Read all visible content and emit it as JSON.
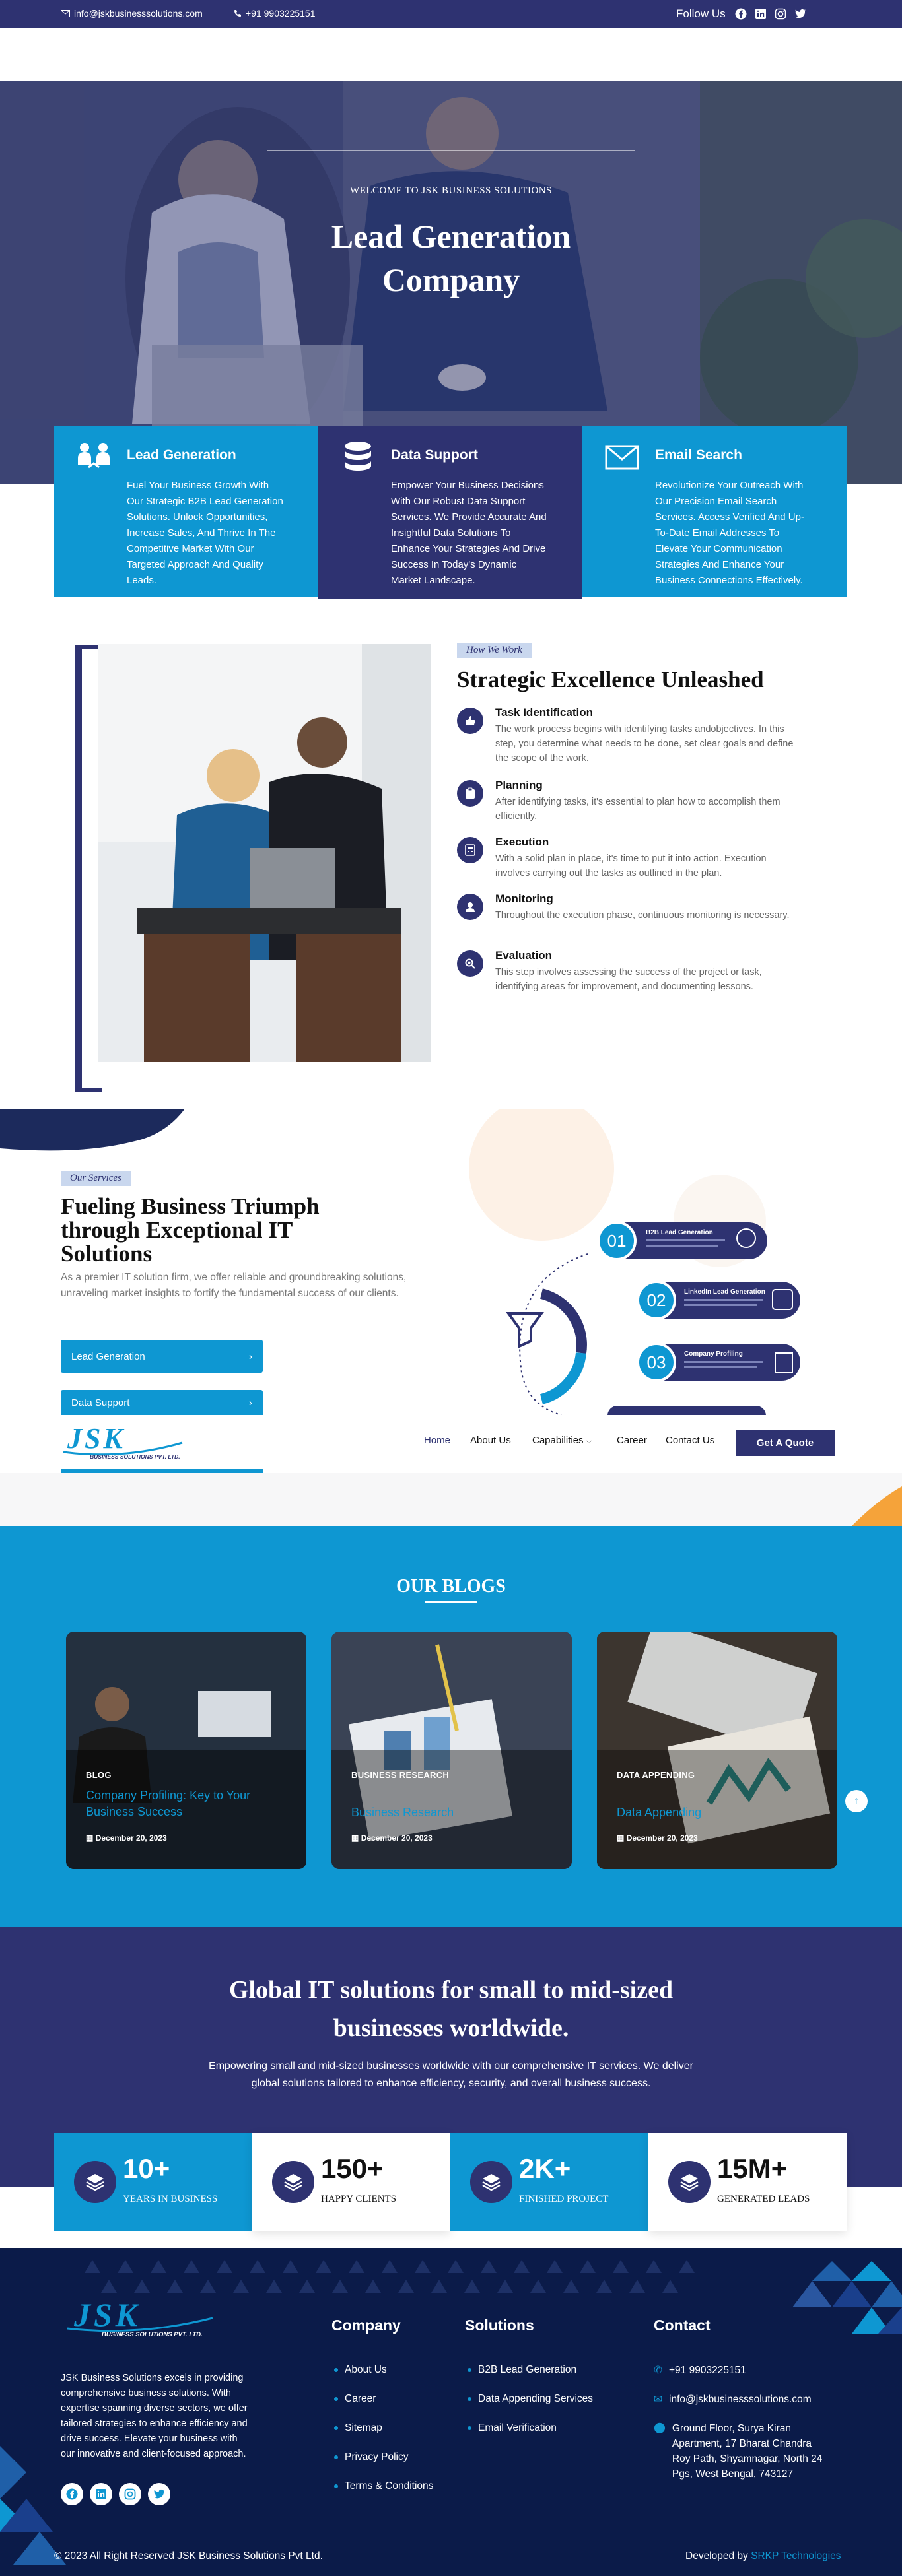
{
  "topbar": {
    "email": "info@jskbusinesssolutions.com",
    "phone": "+91 9903225151",
    "follow_label": "Follow Us"
  },
  "hero": {
    "eyebrow": "WELCOME TO JSK BUSINESS SOLUTIONS",
    "title_line1": "Lead Generation",
    "title_line2": "Company"
  },
  "features": [
    {
      "title": "Lead Generation",
      "text": "Fuel Your Business Growth With Our Strategic B2B Lead Generation Solutions. Unlock Opportunities, Increase Sales, And Thrive In The Competitive Market With Our Targeted Approach And Quality Leads.",
      "icon": "users-icon"
    },
    {
      "title": "Data Support",
      "text": "Empower Your Business Decisions With Our Robust Data Support Services. We Provide Accurate And Insightful Data Solutions To Enhance Your Strategies And Drive Success In Today's Dynamic Market Landscape.",
      "icon": "database-icon"
    },
    {
      "title": "Email Search",
      "text": "Revolutionize Your Outreach With Our Precision Email Search Services. Access Verified And Up-To-Date Email Addresses To Elevate Your Communication Strategies And Enhance Your Business Connections Effectively.",
      "icon": "envelope-icon"
    }
  ],
  "how": {
    "badge": "How We Work",
    "title": "Strategic Excellence Unleashed",
    "steps": [
      {
        "title": "Task Identification",
        "text": "The work process begins with identifying tasks andobjectives. In this step, you determine what needs to be done, set clear goals and define the scope of the work."
      },
      {
        "title": "Planning",
        "text": "After identifying tasks, it's essential to plan how to accomplish them efficiently."
      },
      {
        "title": "Execution",
        "text": "With a solid plan in place, it's time to put it into action. Execution involves carrying out the tasks as outlined in the plan."
      },
      {
        "title": "Monitoring",
        "text": "Throughout the execution phase, continuous monitoring is necessary."
      },
      {
        "title": "Evaluation",
        "text": "This step involves assessing the success of the project or task, identifying areas for improvement, and documenting lessons."
      }
    ]
  },
  "services": {
    "badge": "Our Services",
    "title_line1": "Fueling Business Triumph",
    "title_line2": "through Exceptional IT",
    "title_line3": "Solutions",
    "text": "As a premier IT solution firm, we offer reliable and groundbreaking solutions, unraveling market insights to fortify the fundamental success of our clients.",
    "buttons": [
      "Lead Generation",
      "Data Support"
    ],
    "infographic": [
      {
        "num": "01",
        "label": "B2B Lead Generation"
      },
      {
        "num": "02",
        "label": "LinkedIn Lead Generation"
      },
      {
        "num": "03",
        "label": "Company Profiling"
      }
    ]
  },
  "nav": {
    "logo": "JSK",
    "logo_sub": "BUSINESS SOLUTIONS PVT. LTD.",
    "items": [
      "Home",
      "About Us",
      "Capabilities",
      "Career",
      "Contact Us"
    ],
    "cta": "Get A Quote"
  },
  "blogs": {
    "title": "OUR BLOGS",
    "items": [
      {
        "category": "BLOG",
        "title": "Company Profiling: Key to Your Business Success",
        "date": "December 20, 2023"
      },
      {
        "category": "BUSINESS RESEARCH",
        "title": "Business Research",
        "date": "December 20, 2023"
      },
      {
        "category": "DATA APPENDING",
        "title": "Data Appending",
        "date": "December 20, 2023"
      }
    ]
  },
  "global": {
    "title_line1": "Global IT solutions for small to mid-sized",
    "title_line2": "businesses worldwide.",
    "text_line1": "Empowering small and mid-sized businesses worldwide with our comprehensive IT services. We deliver",
    "text_line2": "global solutions tailored to enhance efficiency, security, and overall business success."
  },
  "stats": [
    {
      "value": "10+",
      "label": "YEARS IN BUSINESS"
    },
    {
      "value": "150+",
      "label": "HAPPY CLIENTS"
    },
    {
      "value": "2K+",
      "label": "FINISHED PROJECT"
    },
    {
      "value": "15M+",
      "label": "GENERATED LEADS"
    }
  ],
  "footer": {
    "about": "JSK Business Solutions excels in providing comprehensive business solutions. With expertise spanning diverse sectors, we offer tailored strategies to enhance efficiency and drive success. Elevate your business with our innovative and client-focused approach.",
    "company_title": "Company",
    "company_links": [
      "About Us",
      "Career",
      "Sitemap",
      "Privacy Policy",
      "Terms & Conditions"
    ],
    "solutions_title": "Solutions",
    "solutions_links": [
      "B2B Lead Generation",
      "Data Appending Services",
      "Email Verification"
    ],
    "contact_title": "Contact",
    "phone": "+91 9903225151",
    "email": "info@jskbusinesssolutions.com",
    "address": "Ground Floor, Surya Kiran Apartment, 17 Bharat Chandra Roy Path, Shyamnagar, North 24 Pgs, West Bengal, 743127",
    "copyright": "© 2023 All Right Reserved JSK Business Solutions Pvt Ltd.",
    "developed_by": "Developed by",
    "developer": "SRKP Technologies"
  },
  "colors": {
    "navy": "#2e3271",
    "blue": "#0e97d2",
    "footer": "#0b1b49"
  }
}
